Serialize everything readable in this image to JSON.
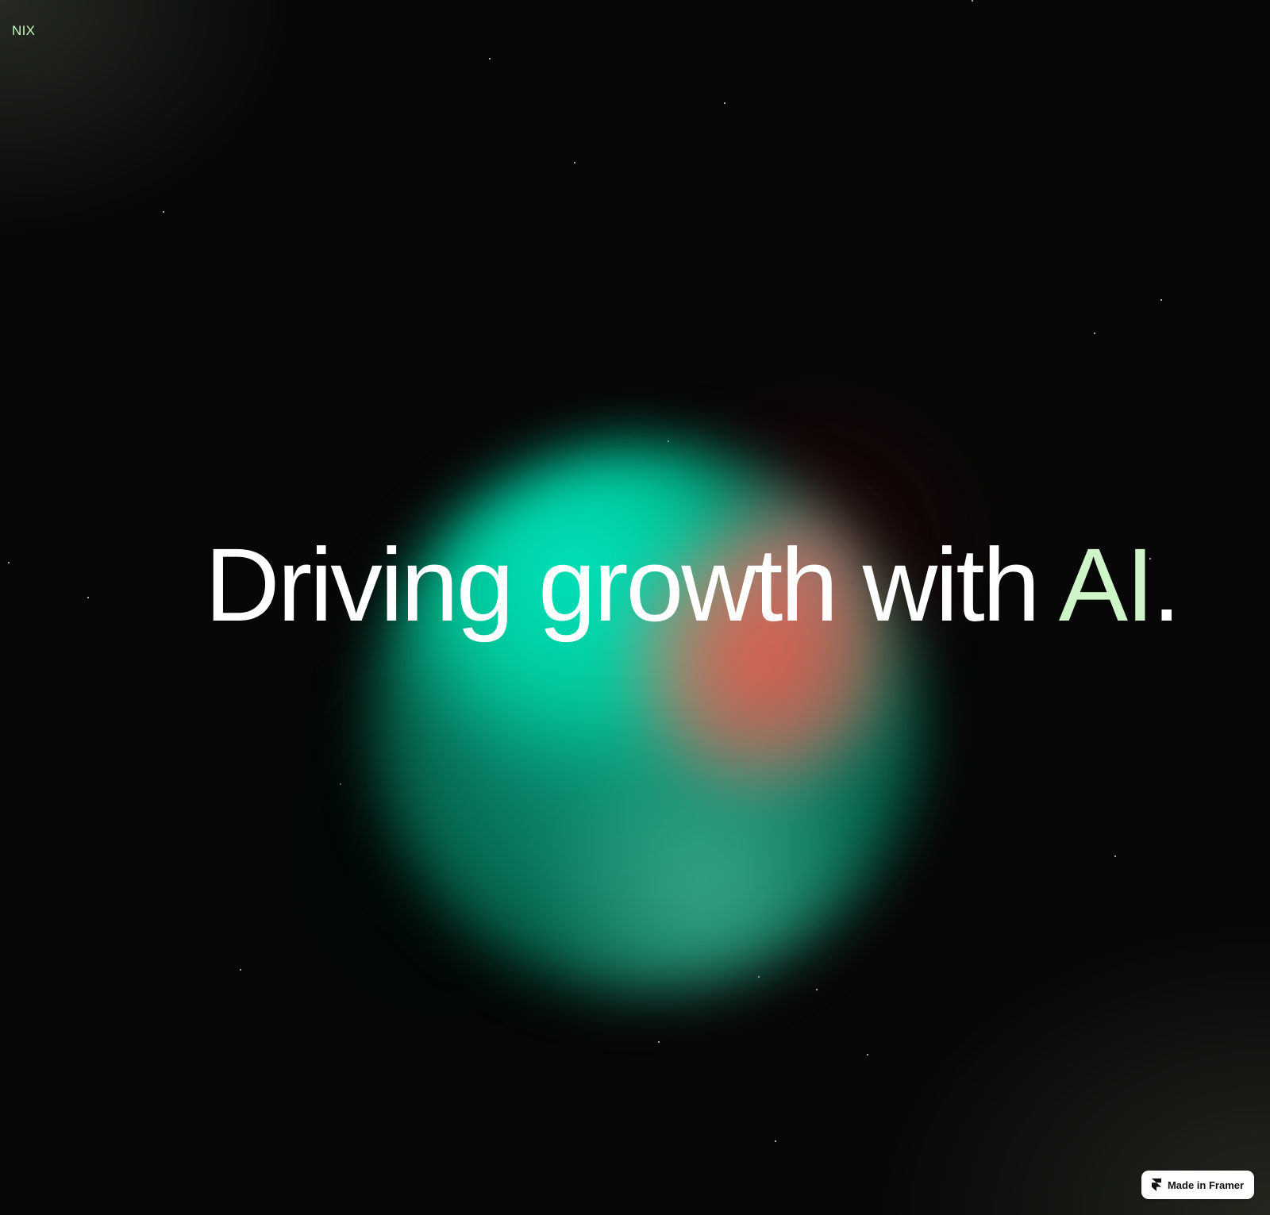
{
  "brand": {
    "logo_text": "NIX",
    "accent_color": "#cdf5c8"
  },
  "hero": {
    "headline_main": "Driving growth with ",
    "headline_accent": "AI",
    "headline_end": ".",
    "orb_colors": [
      "#00e3bd",
      "#f45846",
      "#087a62"
    ]
  },
  "badge": {
    "label": "Made in Framer",
    "icon": "framer-icon"
  }
}
